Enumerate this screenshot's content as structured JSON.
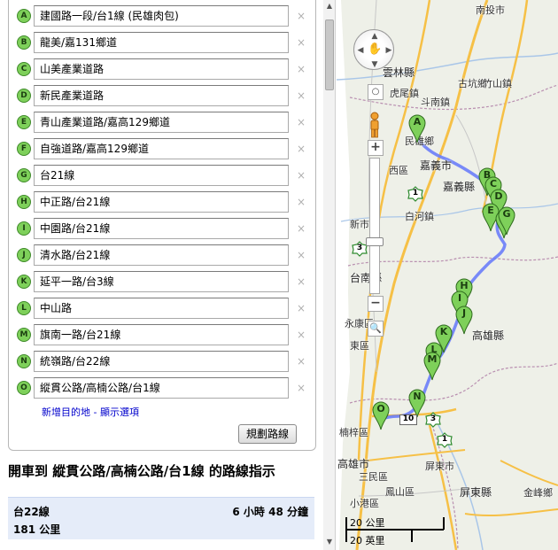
{
  "waypoints": [
    {
      "letter": "A",
      "value": "建國路一段/台1線 (民雄肉包)"
    },
    {
      "letter": "B",
      "value": "龍美/嘉131鄉道"
    },
    {
      "letter": "C",
      "value": "山美產業道路"
    },
    {
      "letter": "D",
      "value": "新民產業道路"
    },
    {
      "letter": "E",
      "value": "青山產業道路/嘉高129鄉道"
    },
    {
      "letter": "F",
      "value": "自強道路/嘉高129鄉道"
    },
    {
      "letter": "G",
      "value": "台21線"
    },
    {
      "letter": "H",
      "value": "中正路/台21線"
    },
    {
      "letter": "I",
      "value": "中園路/台21線"
    },
    {
      "letter": "J",
      "value": "清水路/台21線"
    },
    {
      "letter": "K",
      "value": "延平一路/台3線"
    },
    {
      "letter": "L",
      "value": "中山路"
    },
    {
      "letter": "M",
      "value": "旗南一路/台21線"
    },
    {
      "letter": "N",
      "value": "統嶺路/台22線"
    },
    {
      "letter": "O",
      "value": "縱貫公路/高楠公路/台1線"
    }
  ],
  "remove_icon": "×",
  "add_destination": {
    "label": "新增目的地",
    "separator": " - ",
    "options_label": "顯示選項"
  },
  "plan_button": "規劃路線",
  "route_title": "開車到 縱貫公路/高楠公路/台1線 的路線指示",
  "summary": {
    "route": "台22線",
    "duration": "6 小時 48 分鐘",
    "distance": "181 公里"
  },
  "map": {
    "labels": {
      "nantou": "南投市",
      "yunlin": "雲林縣",
      "huwei": "虎尾鎮",
      "dounan": "斗南鎮",
      "gukeng": "古坑鄉",
      "zhushan": "竹山鎮",
      "minxiong": "民雄鄉",
      "chiayi_city": "嘉義市",
      "west_dist": "西區",
      "chiayi_county": "嘉義縣",
      "baihe": "白河鎮",
      "xinshi": "新市區",
      "tainan_county": "台南縣",
      "yongkang": "永康區",
      "east_dist": "東區",
      "kaohsiung_county": "高雄縣",
      "nanzi": "楠梓區",
      "kaohsiung_city": "高雄市",
      "sanmin": "三民區",
      "fengshan": "鳳山區",
      "xiaogang": "小港區",
      "pingdong_city": "屏東市",
      "pingdong_county": "屏東縣",
      "jinfeng": "金峰鄉"
    },
    "pins": [
      "A",
      "B",
      "C",
      "D",
      "E",
      "F",
      "G",
      "H",
      "I",
      "J",
      "K",
      "L",
      "M",
      "N",
      "O"
    ],
    "highway_shields": [
      "1",
      "3",
      "3",
      "1",
      "10"
    ],
    "scale": {
      "km": "20 公里",
      "mi": "20 英里"
    },
    "pan_icon": "hand-icon",
    "zoom_in": "+",
    "zoom_out": "−",
    "colors": {
      "route": "#6a7dfa",
      "pin": "#7ed05a",
      "highway": "#f6c046",
      "land": "#eef0e8"
    }
  }
}
